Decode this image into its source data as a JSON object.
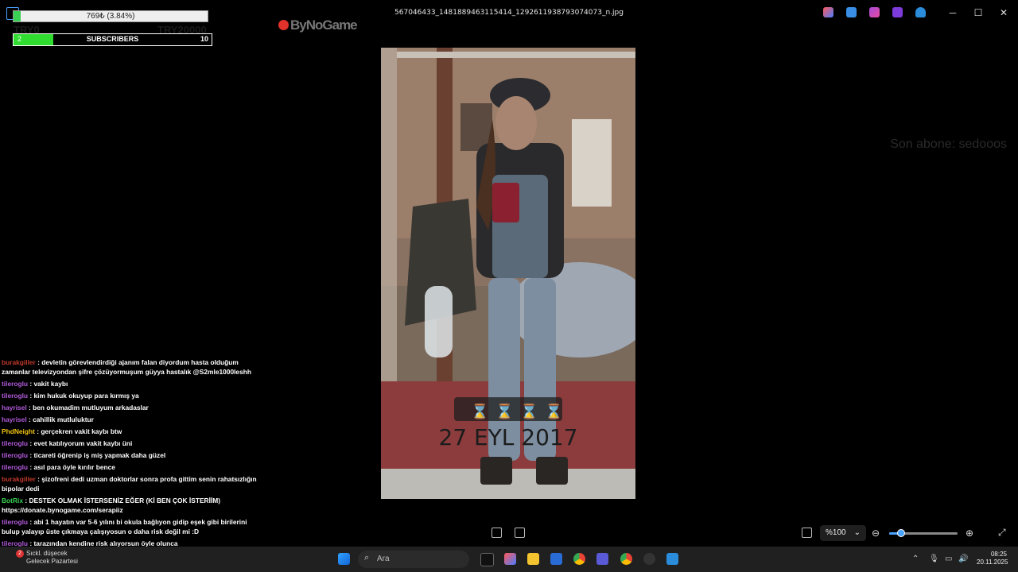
{
  "window": {
    "title": "567046433_1481889463115414_1292611938793074073_n.jpg",
    "controls": {
      "minimize": "─",
      "maximize": "☐",
      "close": "✕"
    }
  },
  "overlay": {
    "donation": {
      "text": "769₺ (3.84%)",
      "progress": 0.0384,
      "min_label": "TRY0",
      "max_label": "TRY20000"
    },
    "subscribers": {
      "current": "2",
      "label": "SUBSCRIBERS",
      "goal": "10",
      "progress": 0.2
    },
    "brand_logo": "ByNoGame",
    "last_subscriber": "Son abone: sedooos",
    "photo": {
      "date_sticker": "27 EYL 2017",
      "hourglass_count": 4
    }
  },
  "chat": [
    {
      "user": "burakgiller",
      "color": "#c0392b",
      "text": ": devletin görevlendirdiği ajanım falan diyordum hasta olduğum zamanlar televizyondan şifre çözüyormuşum güyya hastalık @S2mle1000leshh"
    },
    {
      "user": "tileroglu",
      "color": "#b25bdc",
      "text": ": vakit kaybı"
    },
    {
      "user": "tileroglu",
      "color": "#b25bdc",
      "text": ": kim hukuk okuyup para kırmış ya"
    },
    {
      "user": "hayrisel",
      "color": "#b25bdc",
      "text": ": ben okumadim mutluyum arkadaslar"
    },
    {
      "user": "hayrisel",
      "color": "#b25bdc",
      "text": ": cahillik mutluluktur"
    },
    {
      "user": "PhdNeight",
      "color": "#f1c40f",
      "text": ": gerçekren vakit kaybı btw"
    },
    {
      "user": "tileroglu",
      "color": "#b25bdc",
      "text": ": evet katılıyorum vakit kaybı üni"
    },
    {
      "user": "tileroglu",
      "color": "#b25bdc",
      "text": ": ticareti öğrenip iş miş yapmak daha güzel"
    },
    {
      "user": "tileroglu",
      "color": "#b25bdc",
      "text": ": asıl para öyle kırılır bence"
    },
    {
      "user": "burakgiller",
      "color": "#c0392b",
      "text": ": şizofreni dedi uzman doktorlar sonra profa gittim senin rahatsızlığın bipolar dedi"
    },
    {
      "user": "BotRix",
      "color": "#39d153",
      "text": ": DESTEK OLMAK İSTERSENİZ EĞER (Kİ BEN ÇOK İSTERİİM) https://donate.bynogame.com/serapiiz"
    },
    {
      "user": "tileroglu",
      "color": "#b25bdc",
      "text": ": abi 1 hayatın var 5-6 yılını bi okula bağlıyon gidip eşek gibi birilerini bulup yalayıp üste çıkmaya çalışıyosun o daha risk değil mi :D"
    },
    {
      "user": "tileroglu",
      "color": "#b25bdc",
      "text": ": tarazından kendine risk alıyorsun öyle olunca"
    }
  ],
  "viewer": {
    "zoom_label": "%100",
    "zoom_level": 0.18
  },
  "taskbar": {
    "weather_badge": "2",
    "weather_line1": "Sıckl. düşecek",
    "weather_line2": "Gelecek Pazartesi",
    "search_placeholder": "Ara",
    "time": "08:25",
    "date": "20.11.2025"
  },
  "colors": {
    "accent": "#4aa3ff",
    "progress_green": "#39d153",
    "logo_red": "#e0312b"
  }
}
